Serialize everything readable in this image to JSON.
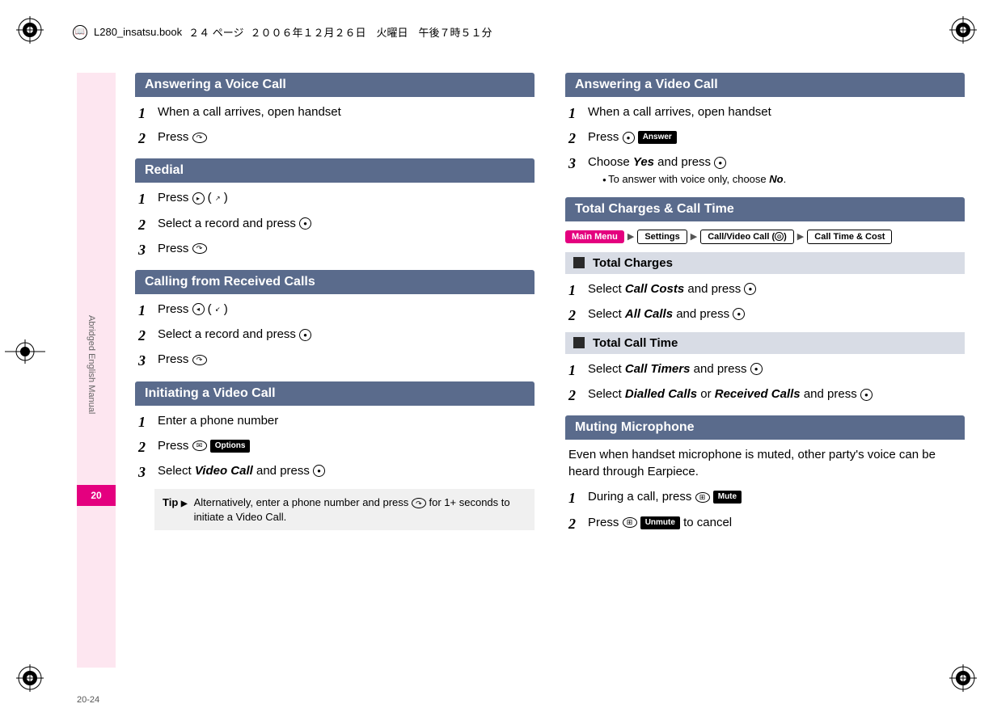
{
  "header": {
    "filename": "L280_insatsu.book",
    "page_info": "２４ ページ",
    "date": "２００６年１２月２６日　火曜日　午後７時５１分"
  },
  "margin": {
    "side_label": "Abridged English Manual",
    "tab_number": "20",
    "page_number": "20-24"
  },
  "left": {
    "s1": {
      "title": "Answering a Voice Call",
      "step1": "When a call arrives, open handset",
      "step2": "Press "
    },
    "s2": {
      "title": "Redial",
      "step1a": "Press ",
      "step1b": " (",
      "step1c": ")",
      "step2a": "Select a record and press ",
      "step3": "Press "
    },
    "s3": {
      "title": "Calling from Received Calls",
      "step1a": "Press ",
      "step1b": " (",
      "step1c": ")",
      "step2a": "Select a record and press ",
      "step3": "Press "
    },
    "s4": {
      "title": "Initiating a Video Call",
      "step1": "Enter a phone number",
      "step2": "Press ",
      "step2_soft": "Options",
      "step3a": "Select ",
      "step3_em": "Video Call",
      "step3b": " and press ",
      "tip_label": "Tip",
      "tip_text": "Alternatively, enter a phone number and press      for 1+ seconds to initiate a Video Call."
    }
  },
  "right": {
    "s1": {
      "title": "Answering a Video Call",
      "step1": "When a call arrives, open handset",
      "step2": "Press ",
      "step2_soft": "Answer",
      "step3a": "Choose ",
      "step3_em": "Yes",
      "step3b": " and press ",
      "note_a": "To answer with voice only, choose ",
      "note_em": "No",
      "note_b": "."
    },
    "s2": {
      "title": "Total Charges & Call Time",
      "nav": {
        "main": "Main Menu",
        "a": "Settings",
        "b": "Call/Video Call (       )",
        "c": "Call Time & Cost"
      },
      "sub1": "Total Charges",
      "sub1_step1a": "Select ",
      "sub1_step1_em": "Call Costs",
      "sub1_step1b": " and press ",
      "sub1_step2a": "Select ",
      "sub1_step2_em": "All Calls",
      "sub1_step2b": " and press ",
      "sub2": "Total Call Time",
      "sub2_step1a": "Select ",
      "sub2_step1_em": "Call Timers",
      "sub2_step1b": " and press ",
      "sub2_step2a": "Select ",
      "sub2_step2_em1": "Dialled Calls",
      "sub2_step2_or": " or ",
      "sub2_step2_em2": "Received Calls",
      "sub2_step2b": " and press "
    },
    "s3": {
      "title": "Muting Microphone",
      "desc": "Even when handset microphone is muted, other party's voice can be heard through Earpiece.",
      "step1": "During a call, press ",
      "step1_soft": "Mute",
      "step2a": "Press ",
      "step2_soft": "Unmute",
      "step2b": " to cancel"
    }
  }
}
